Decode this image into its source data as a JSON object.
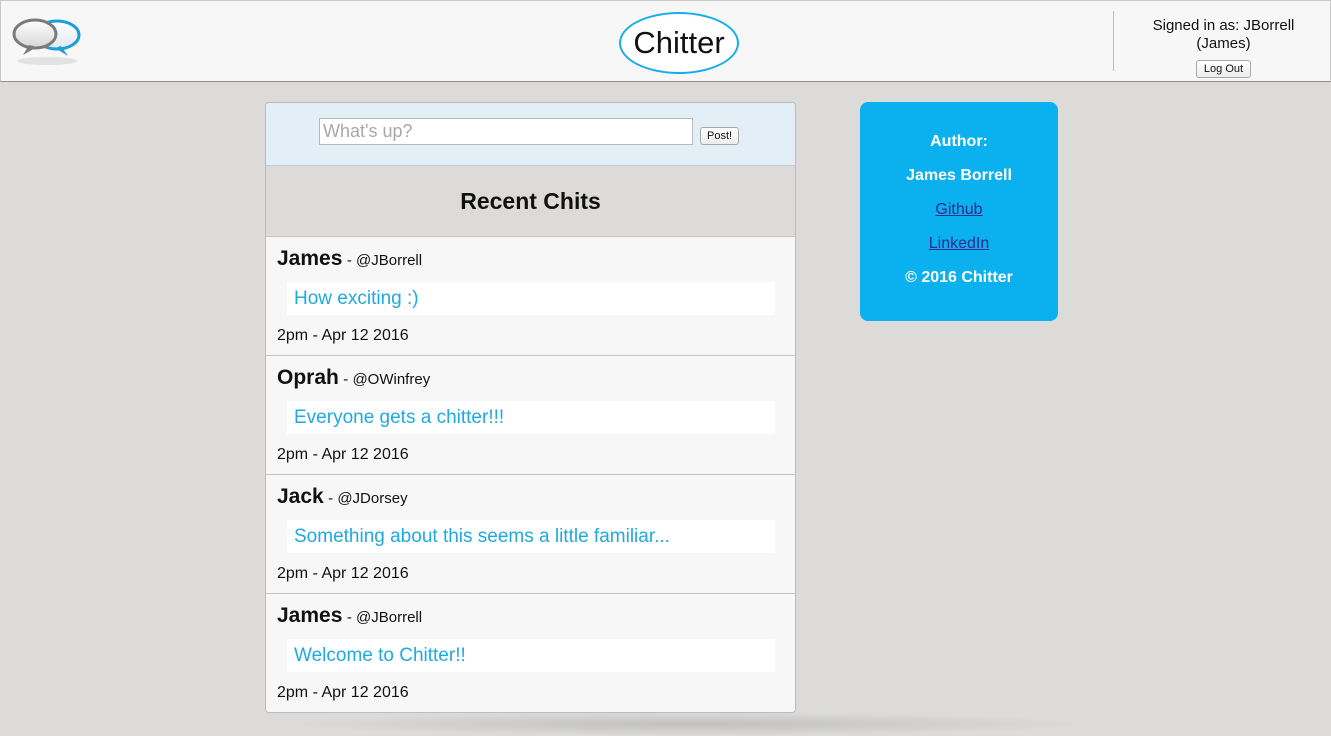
{
  "header": {
    "brand": "Chitter",
    "signed_in_line1": "Signed in as: JBorrell",
    "signed_in_line2": "(James)",
    "logout_label": "Log Out"
  },
  "composer": {
    "placeholder": "What's up?",
    "post_label": "Post!"
  },
  "feed": {
    "title": "Recent Chits",
    "chits": [
      {
        "name": "James",
        "handle": "- @JBorrell",
        "text": "How exciting :)",
        "time": "2pm - Apr 12 2016"
      },
      {
        "name": "Oprah",
        "handle": "- @OWinfrey",
        "text": "Everyone gets a chitter!!!",
        "time": "2pm - Apr 12 2016"
      },
      {
        "name": "Jack",
        "handle": "- @JDorsey",
        "text": "Something about this seems a little familiar...",
        "time": "2pm - Apr 12 2016"
      },
      {
        "name": "James",
        "handle": "- @JBorrell",
        "text": "Welcome to Chitter!!",
        "time": "2pm - Apr 12 2016"
      }
    ]
  },
  "author_card": {
    "heading": "Author:",
    "name": "James Borrell",
    "github": "Github",
    "linkedin": "LinkedIn",
    "copyright": "© 2016 Chitter"
  },
  "colors": {
    "accent": "#0bb1ef",
    "chit_text": "#1fa9e1",
    "background": "#dcdbd9"
  }
}
